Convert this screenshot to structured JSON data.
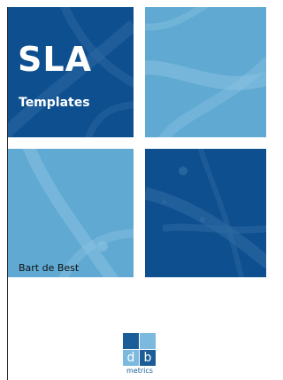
{
  "cover": {
    "title": "SLA",
    "subtitle": "Templates",
    "author": "Bart de Best"
  },
  "logo": {
    "letter_left": "d",
    "letter_right": "b",
    "word": "metrics"
  },
  "colors": {
    "dark_blue": "#0d4f8f",
    "light_blue": "#5fa9d2",
    "background": "#ffffff",
    "text_white": "#ffffff",
    "text_dark": "#111111"
  }
}
